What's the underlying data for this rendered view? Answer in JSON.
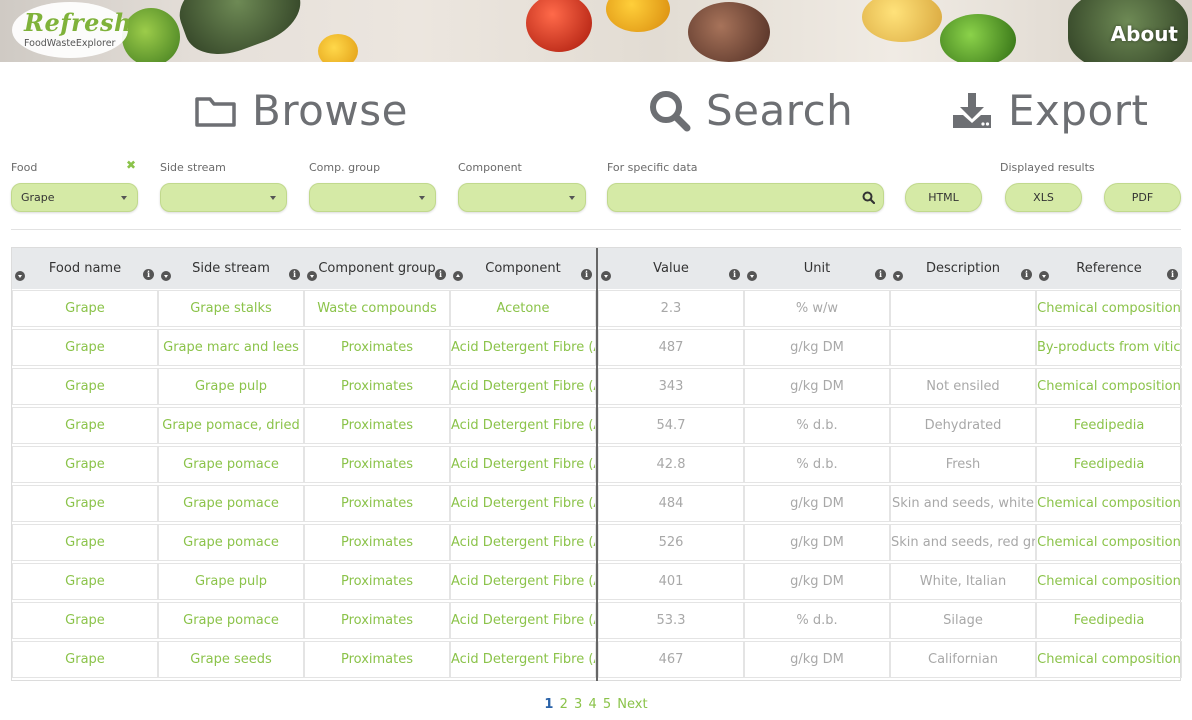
{
  "header": {
    "logo_main": "Refresh",
    "logo_sub": "FoodWasteExplorer",
    "about_label": "About"
  },
  "nav": {
    "browse": "Browse",
    "search": "Search",
    "export": "Export"
  },
  "filters": {
    "food": {
      "label": "Food",
      "value": "Grape"
    },
    "side_stream": {
      "label": "Side stream",
      "value": ""
    },
    "comp_group": {
      "label": "Comp. group",
      "value": ""
    },
    "component": {
      "label": "Component",
      "value": ""
    },
    "specific": {
      "label": "For specific data",
      "placeholder": ""
    },
    "displayed_results": "Displayed results",
    "export_buttons": [
      "HTML",
      "XLS",
      "PDF"
    ]
  },
  "table": {
    "columns": [
      "Food name",
      "Side stream",
      "Component group",
      "Component",
      "Value",
      "Unit",
      "Description",
      "Reference"
    ],
    "rows": [
      [
        "Grape",
        "Grape stalks",
        "Waste compounds",
        "Acetone",
        "2.3",
        "% w/w",
        "",
        "Chemical composition"
      ],
      [
        "Grape",
        "Grape marc and lees",
        "Proximates",
        "Acid Detergent Fibre (ADF)",
        "487",
        "g/kg DM",
        "",
        "By-products from viticulture"
      ],
      [
        "Grape",
        "Grape pulp",
        "Proximates",
        "Acid Detergent Fibre (ADF)",
        "343",
        "g/kg DM",
        "Not ensiled",
        "Chemical composition"
      ],
      [
        "Grape",
        "Grape pomace, dried",
        "Proximates",
        "Acid Detergent Fibre (ADF)",
        "54.7",
        "% d.b.",
        "Dehydrated",
        "Feedipedia"
      ],
      [
        "Grape",
        "Grape pomace",
        "Proximates",
        "Acid Detergent Fibre (ADF)",
        "42.8",
        "% d.b.",
        "Fresh",
        "Feedipedia"
      ],
      [
        "Grape",
        "Grape pomace",
        "Proximates",
        "Acid Detergent Fibre (ADF)",
        "484",
        "g/kg DM",
        "Skin and seeds, white",
        "Chemical composition"
      ],
      [
        "Grape",
        "Grape pomace",
        "Proximates",
        "Acid Detergent Fibre (ADF)",
        "526",
        "g/kg DM",
        "Skin and seeds, red grape",
        "Chemical composition"
      ],
      [
        "Grape",
        "Grape pulp",
        "Proximates",
        "Acid Detergent Fibre (ADF)",
        "401",
        "g/kg DM",
        "White, Italian",
        "Chemical composition"
      ],
      [
        "Grape",
        "Grape pomace",
        "Proximates",
        "Acid Detergent Fibre (ADF)",
        "53.3",
        "% d.b.",
        "Silage",
        "Feedipedia"
      ],
      [
        "Grape",
        "Grape seeds",
        "Proximates",
        "Acid Detergent Fibre (ADF)",
        "467",
        "g/kg DM",
        "Californian",
        "Chemical composition"
      ]
    ]
  },
  "pagination": {
    "pages": [
      "1",
      "2",
      "3",
      "4",
      "5"
    ],
    "current": "1",
    "next": "Next"
  },
  "colors": {
    "accent_green": "#8bc34a",
    "control_fill": "#d5eaa6",
    "nav_gray": "#6d6f73",
    "current_page": "#2a62a8"
  }
}
